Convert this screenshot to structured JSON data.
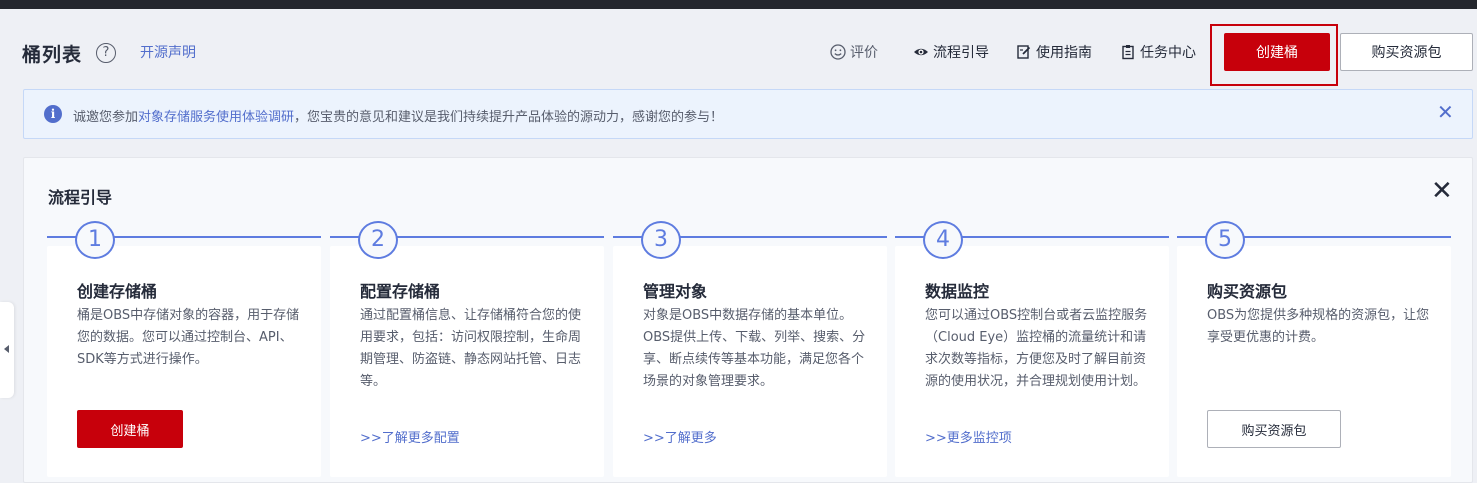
{
  "header": {
    "title": "桶列表",
    "help_icon": "question-circle-icon",
    "oss_link": "开源声明",
    "tools": {
      "rate": "评价",
      "flow": "流程引导",
      "guide": "使用指南",
      "task": "任务中心"
    },
    "create_button": "创建桶",
    "buy_button": "购买资源包"
  },
  "notice": {
    "prefix": "诚邀您参加",
    "link": "对象存储服务使用体验调研",
    "suffix": "，您宝贵的意见和建议是我们持续提升产品体验的源动力，感谢您的参与！",
    "icon": "info-icon",
    "close_icon": "close-icon"
  },
  "guide": {
    "title": "流程引导",
    "close_icon": "close-icon",
    "steps": [
      {
        "num": "1",
        "title": "创建存储桶",
        "desc": "桶是OBS中存储对象的容器，用于存储您的数据。您可以通过控制台、API、SDK等方式进行操作。",
        "button": "创建桶"
      },
      {
        "num": "2",
        "title": "配置存储桶",
        "desc": "通过配置桶信息、让存储桶符合您的使用要求，包括：访问权限控制，生命周期管理、防盗链、静态网站托管、日志等。",
        "link": ">>了解更多配置"
      },
      {
        "num": "3",
        "title": "管理对象",
        "desc": "对象是OBS中数据存储的基本单位。OBS提供上传、下载、列举、搜索、分享、断点续传等基本功能，满足您各个场景的对象管理要求。",
        "link": ">>了解更多"
      },
      {
        "num": "4",
        "title": "数据监控",
        "desc": "您可以通过OBS控制台或者云监控服务（Cloud Eye）监控桶的流量统计和请求次数等指标，方便您及时了解目前资源的使用状况，并合理规划使用计划。",
        "link": ">>更多监控项"
      },
      {
        "num": "5",
        "title": "购买资源包",
        "desc": "OBS为您提供多种规格的资源包，让您享受更优惠的计费。",
        "button": "购买资源包"
      }
    ]
  },
  "colors": {
    "brand_red": "#c7000b",
    "link_blue": "#526ecc",
    "step_blue": "#5e7ce0"
  }
}
